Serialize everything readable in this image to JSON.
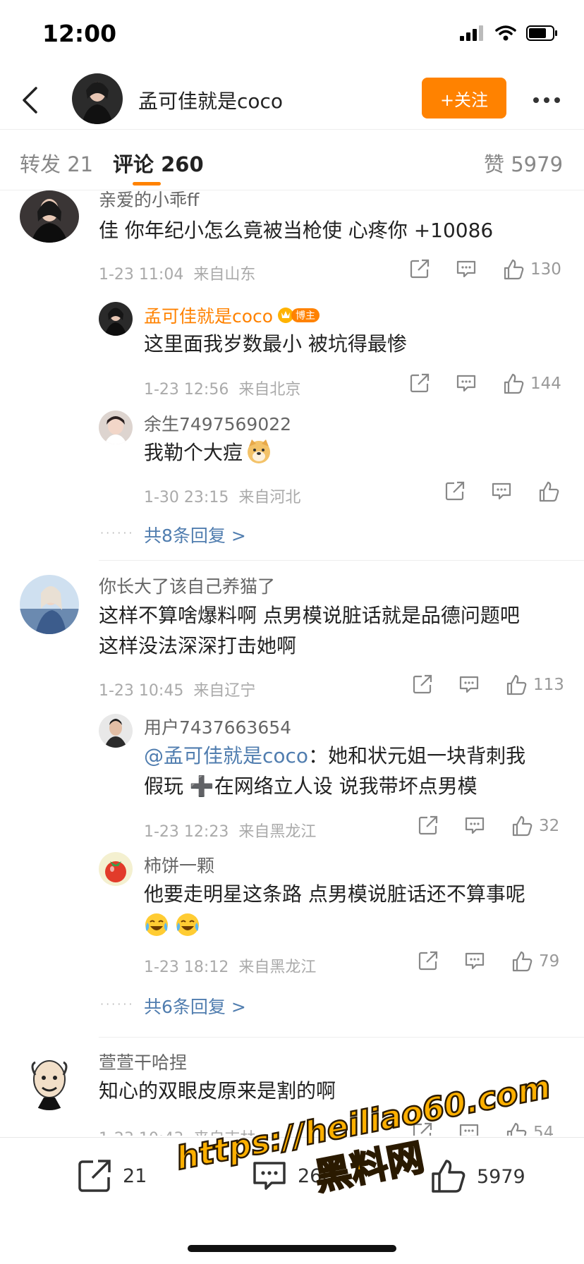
{
  "status": {
    "time": "12:00"
  },
  "header": {
    "name": "孟可佳就是coco",
    "follow_label": "+关注"
  },
  "tabs": {
    "repost": "转发 21",
    "comment": "评论 260",
    "like": "赞 5979"
  },
  "comments": [
    {
      "user": "亲爱的小乖ff",
      "text": "佳 你年纪小怎么竟被当枪使 心疼你 +10086",
      "time": "1-23 11:04",
      "location": "来自山东",
      "likes": "130",
      "replies": [
        {
          "user": "孟可佳就是coco",
          "badge": "博主",
          "text": "这里面我岁数最小 被坑得最惨",
          "time": "1-23 12:56",
          "location": "来自北京",
          "likes": "144"
        },
        {
          "user": "余生7497569022",
          "text": "我勒个大痘",
          "time": "1-30 23:15",
          "location": "来自河北",
          "likes": ""
        }
      ],
      "more": "共8条回复 >"
    },
    {
      "user": "你长大了该自己养猫了",
      "text_lines": [
        "这样不算啥爆料啊 点男模说脏话就是品德问题吧",
        "这样没法深深打击她啊"
      ],
      "time": "1-23 10:45",
      "location": "来自辽宁",
      "likes": "113",
      "replies": [
        {
          "user": "用户7437663654",
          "mention": "@孟可佳就是coco",
          "text_line1": "：她和状元姐一块背刺我",
          "text_line2": "假玩 ➕在网络立人设 说我带坏点男模",
          "time": "1-23 12:23",
          "location": "来自黑龙江",
          "likes": "32"
        },
        {
          "user": "柿饼一颗",
          "text": "他要走明星这条路 点男模说脏话还不算事呢",
          "time": "1-23 18:12",
          "location": "来自黑龙江",
          "likes": "79"
        }
      ],
      "more": "共6条回复 >"
    },
    {
      "user": "萱萱干哈捏",
      "text": "知心的双眼皮原来是割的啊",
      "time": "1-23 10:43",
      "location": "来自吉林",
      "likes": "54"
    }
  ],
  "bottom_bar": {
    "repost_count": "21",
    "comment_count": "260",
    "like_count": "5979"
  },
  "watermark": {
    "line1": "https://heiliao60.com",
    "line2": "黑料网"
  },
  "colors": {
    "accent": "#ff8200",
    "link": "#507daf",
    "meta": "#aaa"
  }
}
